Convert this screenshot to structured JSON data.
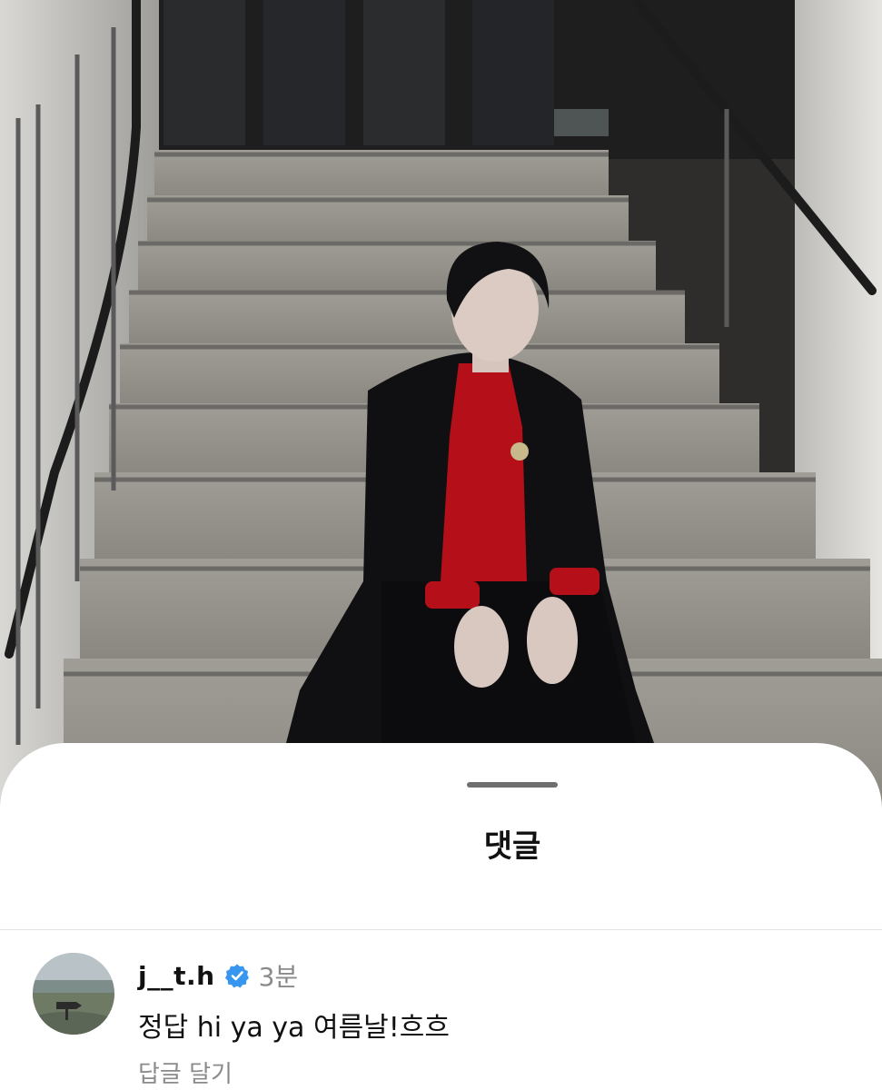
{
  "sheet": {
    "title": "댓글"
  },
  "comment": {
    "username": "j__t.h",
    "verified": true,
    "time": "3분",
    "text": "정답 hi ya ya 여름날!흐흐",
    "reply_label": "답글 달기",
    "avatar": "landscape-avatar"
  },
  "icons": {
    "verified": "verified-badge-icon"
  },
  "colors": {
    "verified_badge": "#3797f0",
    "secondary_text": "#8a8a8a",
    "primary_text": "#111111",
    "sheet_background": "#ffffff"
  }
}
